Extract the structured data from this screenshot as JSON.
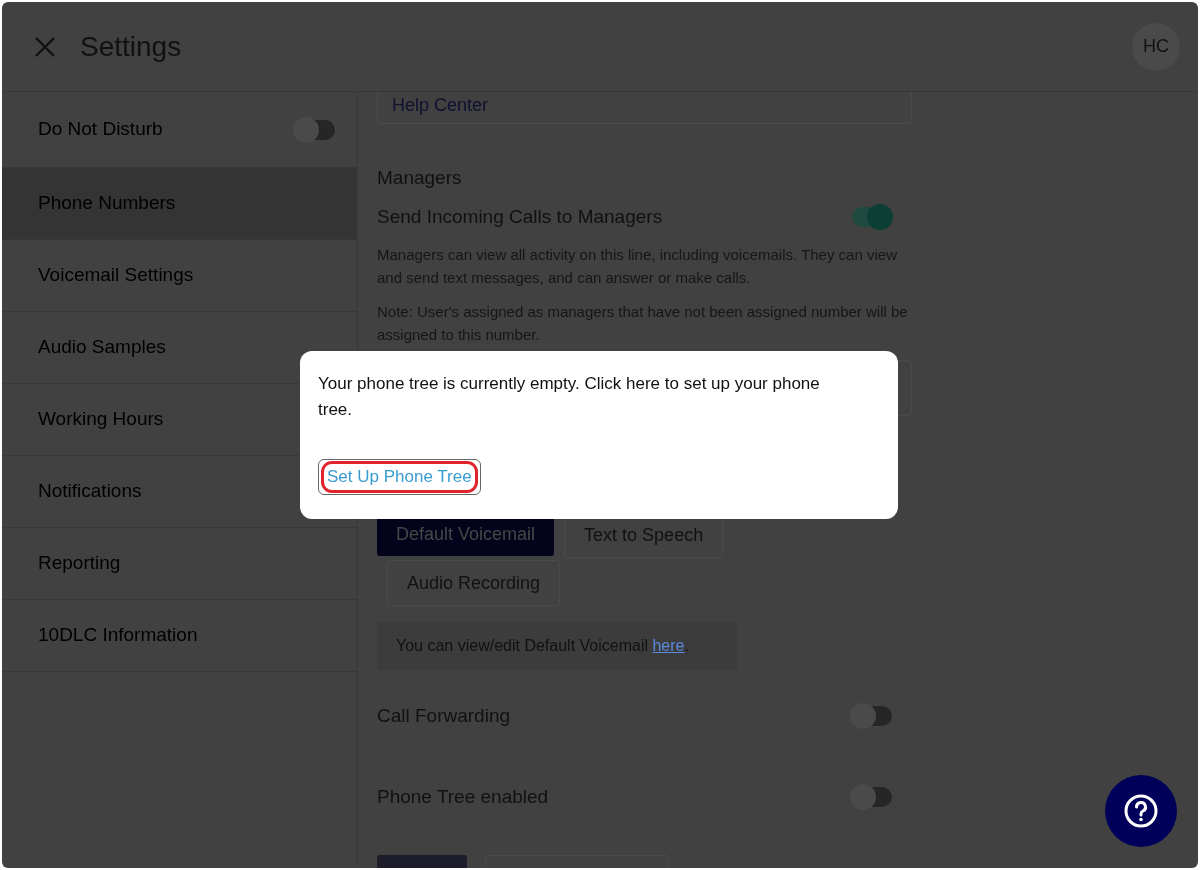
{
  "header": {
    "title": "Settings",
    "avatar": "HC"
  },
  "sidebar": {
    "items": [
      {
        "label": "Do Not Disturb",
        "selected": false,
        "kind": "toggle",
        "on": false
      },
      {
        "label": "Phone Numbers",
        "selected": true,
        "kind": "link"
      },
      {
        "label": "Voicemail Settings",
        "selected": false,
        "kind": "link"
      },
      {
        "label": "Audio Samples",
        "selected": false,
        "kind": "link"
      },
      {
        "label": "Working Hours",
        "selected": false,
        "kind": "link"
      },
      {
        "label": "Notifications",
        "selected": false,
        "kind": "link"
      },
      {
        "label": "Reporting",
        "selected": false,
        "kind": "link"
      },
      {
        "label": "10DLC Information",
        "selected": false,
        "kind": "link"
      }
    ]
  },
  "content": {
    "help_field": {
      "value": "Help Center"
    },
    "managers": {
      "heading": "Managers",
      "label": "Send Incoming Calls to Managers",
      "on": true,
      "description": "Managers can view all activity on this line, including voicemails. They can view and send text messages, and can answer or make calls.",
      "note": "Note: User's assigned as managers that have not been assigned number will be assigned to this number."
    },
    "voicemail_options": [
      {
        "label": "Default Voicemail",
        "selected": true
      },
      {
        "label": "Text to Speech",
        "selected": false
      },
      {
        "label": "Audio Recording",
        "selected": false
      }
    ],
    "info": {
      "text": "You can view/edit Default Voicemail",
      "link": "here",
      "end": "."
    },
    "toggles": [
      {
        "label": "Call Forwarding",
        "on": false
      },
      {
        "label": "Phone Tree enabled",
        "on": false
      }
    ]
  },
  "popup": {
    "message": "Your phone tree is currently empty. Click here to set up your phone tree.",
    "button": {
      "label": "Set Up Phone Tree",
      "focused": true
    }
  }
}
